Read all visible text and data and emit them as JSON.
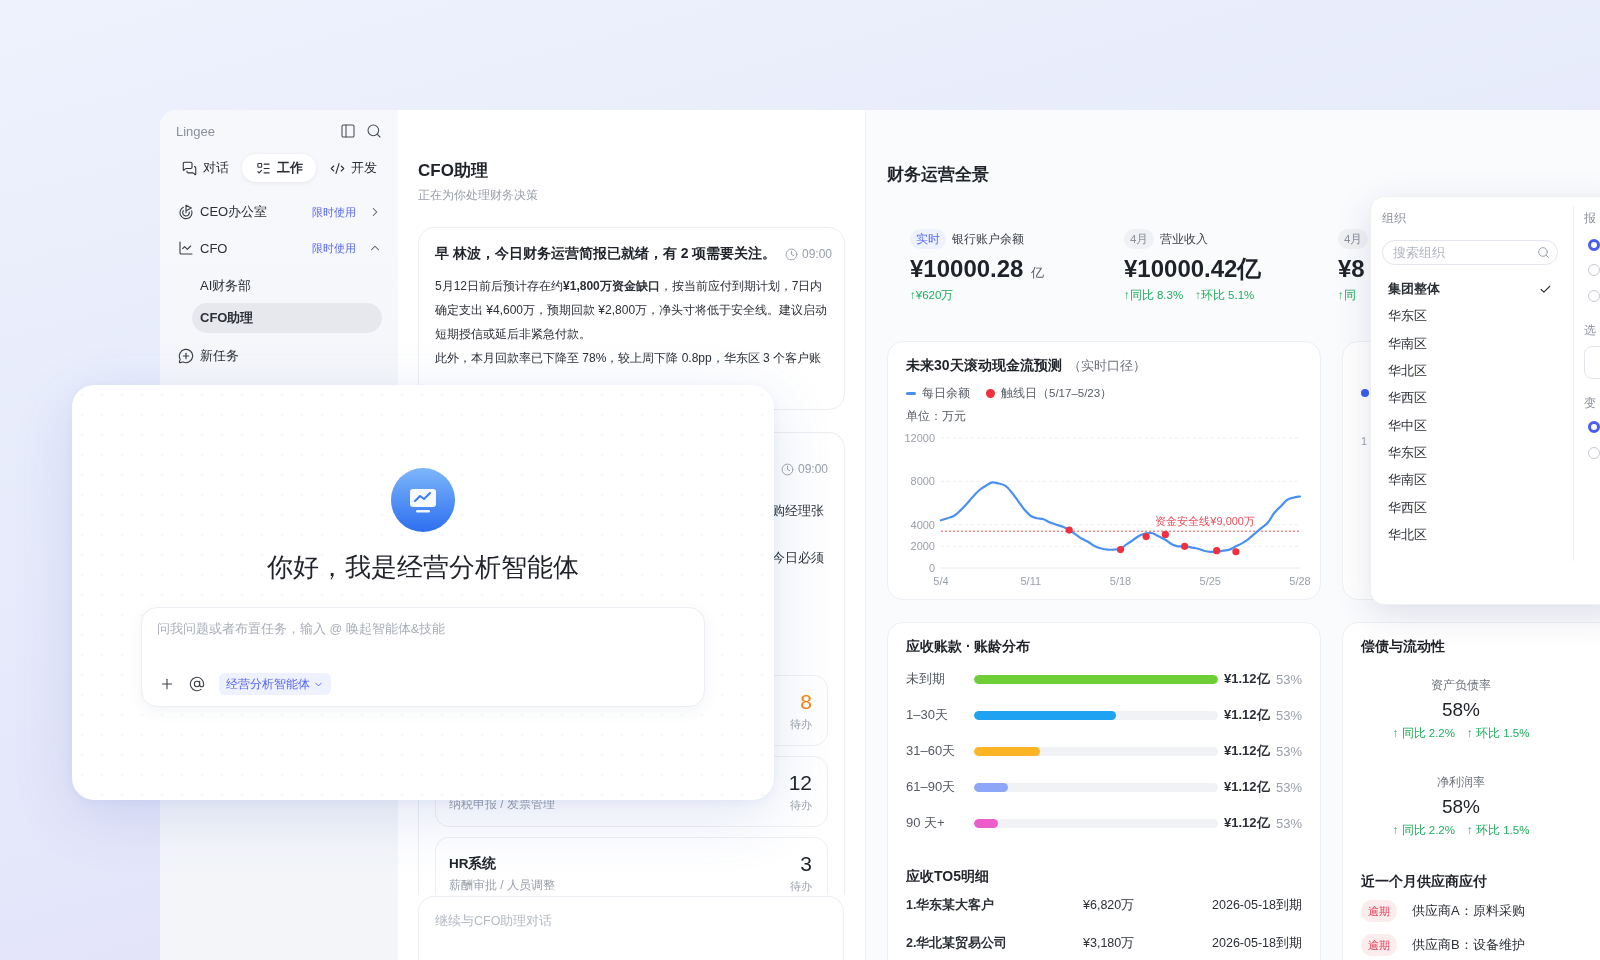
{
  "sidebar": {
    "brand": "Lingee",
    "tabs": [
      {
        "label": "对话",
        "selected": false
      },
      {
        "label": "工作",
        "selected": true
      },
      {
        "label": "开发",
        "selected": false
      }
    ],
    "nav": [
      {
        "kind": "group",
        "label": "CEO办公室",
        "badge": "限时使用",
        "expanded": false
      },
      {
        "kind": "group",
        "label": "CFO",
        "badge": "限时使用",
        "expanded": true,
        "children": [
          {
            "label": "AI财务部",
            "selected": false
          },
          {
            "label": "CFO助理",
            "selected": true
          }
        ]
      },
      {
        "kind": "action",
        "label": "新任务"
      }
    ]
  },
  "assistant": {
    "title": "CFO助理",
    "subtitle": "正在为你处理财务决策",
    "briefing": {
      "title": "早 林波，今日财务运营简报已就绪，有 2 项需要关注。",
      "time": "09:00",
      "paragraphs": [
        "5月12日前后预计存在约**¥1,800万资金缺口**，按当前应付到期计划，7日内确定支出 ¥4,600万，预期回款 ¥2,800万，净头寸将低于安全线。建议启动短期授信或延后非紧急付款。",
        "此外，本月回款率已下降至 78%，较上周下降 0.8pp，华东区 3 个客户账"
      ]
    },
    "message": {
      "time": "09:00",
      "fragments": [
        "购经理张",
        "今日必须"
      ]
    },
    "tasks": [
      {
        "count": "8",
        "count_label": "待办",
        "highlight": true
      },
      {
        "subtitle": "纳税申报 / 发票管理",
        "count": "12",
        "count_label": "待办",
        "highlight": false
      },
      {
        "title": "HR系统",
        "subtitle": "薪酬审批 / 人员调整",
        "count": "3",
        "count_label": "待办",
        "highlight": false
      }
    ],
    "chat_input": {
      "placeholder": "继续与CFO助理对话"
    }
  },
  "welcome_dialog": {
    "greeting": "你好，我是经营分析智能体",
    "prompt": {
      "placeholder": "问我问题或者布置任务，输入 @ 唤起智能体&技能"
    },
    "agent_chip": "经营分析智能体"
  },
  "dashboard": {
    "title": "财务运营全景",
    "kpis": [
      {
        "tag": "实时",
        "live": true,
        "label": "银行账户余额",
        "value": "¥10000.28",
        "unit": "亿",
        "deltas": [
          "↑¥620万"
        ]
      },
      {
        "tag": "4月",
        "live": false,
        "label": "营业收入",
        "value": "¥10000.42亿",
        "deltas": [
          "↑同比 8.3%",
          "↑环比 5.1%"
        ]
      },
      {
        "tag": "4月",
        "live": false,
        "value": "¥8",
        "deltas": [
          "↑同"
        ]
      }
    ],
    "cashflow": {
      "title": "未来30天滚动现金流预测",
      "note": "（实时口径）",
      "chart_data": {
        "type": "line",
        "ylabel": "单位：万元",
        "categories": [
          "5/4",
          null,
          null,
          null,
          null,
          null,
          null,
          null,
          null,
          null,
          null,
          null,
          null,
          null,
          "5/11",
          null,
          null,
          null,
          null,
          null,
          null,
          null,
          null,
          null,
          null,
          null,
          null,
          null,
          "5/18",
          null,
          null,
          null,
          null,
          null,
          null,
          null,
          null,
          null,
          null,
          null,
          null,
          null,
          "5/25",
          null,
          null,
          null,
          null,
          null,
          null,
          null,
          null,
          null,
          null,
          null,
          null,
          null,
          "5/28"
        ],
        "ylim": [
          0,
          12000
        ],
        "yticks": [
          0,
          2000,
          4000,
          8000,
          12000
        ],
        "grid": true,
        "series": [
          {
            "name": "每日余额",
            "color": "#4a90f2",
            "values": [
              4400,
              4600,
              4800,
              5300,
              5900,
              6600,
              7200,
              7600,
              7900,
              7800,
              7600,
              7000,
              6200,
              5400,
              4800,
              4600,
              4500,
              4200,
              4000,
              3800,
              3500,
              3100,
              2700,
              2400,
              2000,
              1800,
              1700,
              1700,
              1800,
              2200,
              2600,
              3000,
              3200,
              3200,
              2900,
              2600,
              2200,
              2000,
              2000,
              1900,
              1800,
              1600,
              1500,
              1500,
              1600,
              1700,
              2000,
              2300,
              2700,
              3200,
              3700,
              4200,
              5100,
              5700,
              6300,
              6500,
              6600
            ]
          },
          {
            "name": "触线日（5/17–5/23）",
            "type": "scatter",
            "color": "#f0303f",
            "values": [
              null,
              null,
              null,
              null,
              null,
              null,
              null,
              null,
              null,
              null,
              null,
              null,
              null,
              null,
              null,
              null,
              null,
              null,
              null,
              null,
              3500,
              null,
              null,
              null,
              null,
              null,
              null,
              null,
              1700,
              null,
              null,
              null,
              2900,
              null,
              null,
              3100,
              null,
              null,
              2000,
              null,
              null,
              null,
              null,
              1600,
              null,
              null,
              1500,
              null,
              null,
              null,
              null,
              null,
              null,
              null,
              null,
              null,
              null
            ]
          }
        ],
        "ref_lines": [
          {
            "axis": "y",
            "value": 3400,
            "label": "资金安全线¥9,000万"
          }
        ]
      }
    },
    "covered_card": {
      "axis_fragment": "1"
    },
    "aging": {
      "title": "应收账款 · 账龄分布",
      "buckets": [
        {
          "label": "未到期",
          "level": 1,
          "amount": "¥1.12亿",
          "share": "53%",
          "color": "#6dcf35"
        },
        {
          "label": "1–30天",
          "level": 0.58,
          "amount": "¥1.12亿",
          "share": "53%",
          "color": "#1fa2f2"
        },
        {
          "label": "31–60天",
          "level": 0.27,
          "amount": "¥1.12亿",
          "share": "53%",
          "color": "#fbb424"
        },
        {
          "label": "61–90天",
          "level": 0.14,
          "amount": "¥1.12亿",
          "share": "53%",
          "color": "#8ea6f7"
        },
        {
          "label": "90 天+",
          "level": 0.1,
          "amount": "¥1.12亿",
          "share": "53%",
          "color": "#ec5ccb"
        }
      ],
      "top5_title": "应收TO5明细",
      "top5": [
        {
          "name": "1.华东某大客户",
          "amount": "¥6,820万",
          "due": "2026-05-18到期"
        },
        {
          "name": "2.华北某贸易公司",
          "amount": "¥3,180万",
          "due": "2026-05-18到期"
        }
      ]
    },
    "solvency": {
      "title": "偿债与流动性",
      "metrics": [
        {
          "label": "资产负债率",
          "value": "58%",
          "deltas": [
            "↑ 同比 2.2%",
            "↑ 环比 1.5%"
          ]
        },
        {
          "label": "净利润率",
          "value": "58%",
          "deltas": [
            "↑ 同比 2.2%",
            "↑ 环比 1.5%"
          ]
        }
      ],
      "payables_title": "近一个月供应商应付",
      "payables": [
        {
          "tag": "逾期",
          "text": "供应商A：原料采购"
        },
        {
          "tag": "逾期",
          "text": "供应商B：设备维护"
        }
      ]
    }
  },
  "org_menu": {
    "label": "组织",
    "search": {
      "placeholder": "搜索组织"
    },
    "options": [
      {
        "label": "集团整体",
        "selected": true
      },
      {
        "label": "华东区",
        "selected": false
      },
      {
        "label": "华南区",
        "selected": false
      },
      {
        "label": "华北区",
        "selected": false
      },
      {
        "label": "华西区",
        "selected": false
      },
      {
        "label": "华中区",
        "selected": false
      },
      {
        "label": "华东区",
        "selected": false
      },
      {
        "label": "华南区",
        "selected": false
      },
      {
        "label": "华西区",
        "selected": false
      },
      {
        "label": "华北区",
        "selected": false
      }
    ],
    "side_sections": [
      {
        "kind": "radios",
        "label": "报",
        "options": [
          {
            "selected": true
          },
          {
            "selected": false
          },
          {
            "selected": false
          }
        ]
      },
      {
        "kind": "field",
        "label": "选"
      },
      {
        "kind": "radios",
        "label": "变",
        "options": [
          {
            "selected": true
          },
          {
            "selected": false
          }
        ]
      }
    ]
  }
}
